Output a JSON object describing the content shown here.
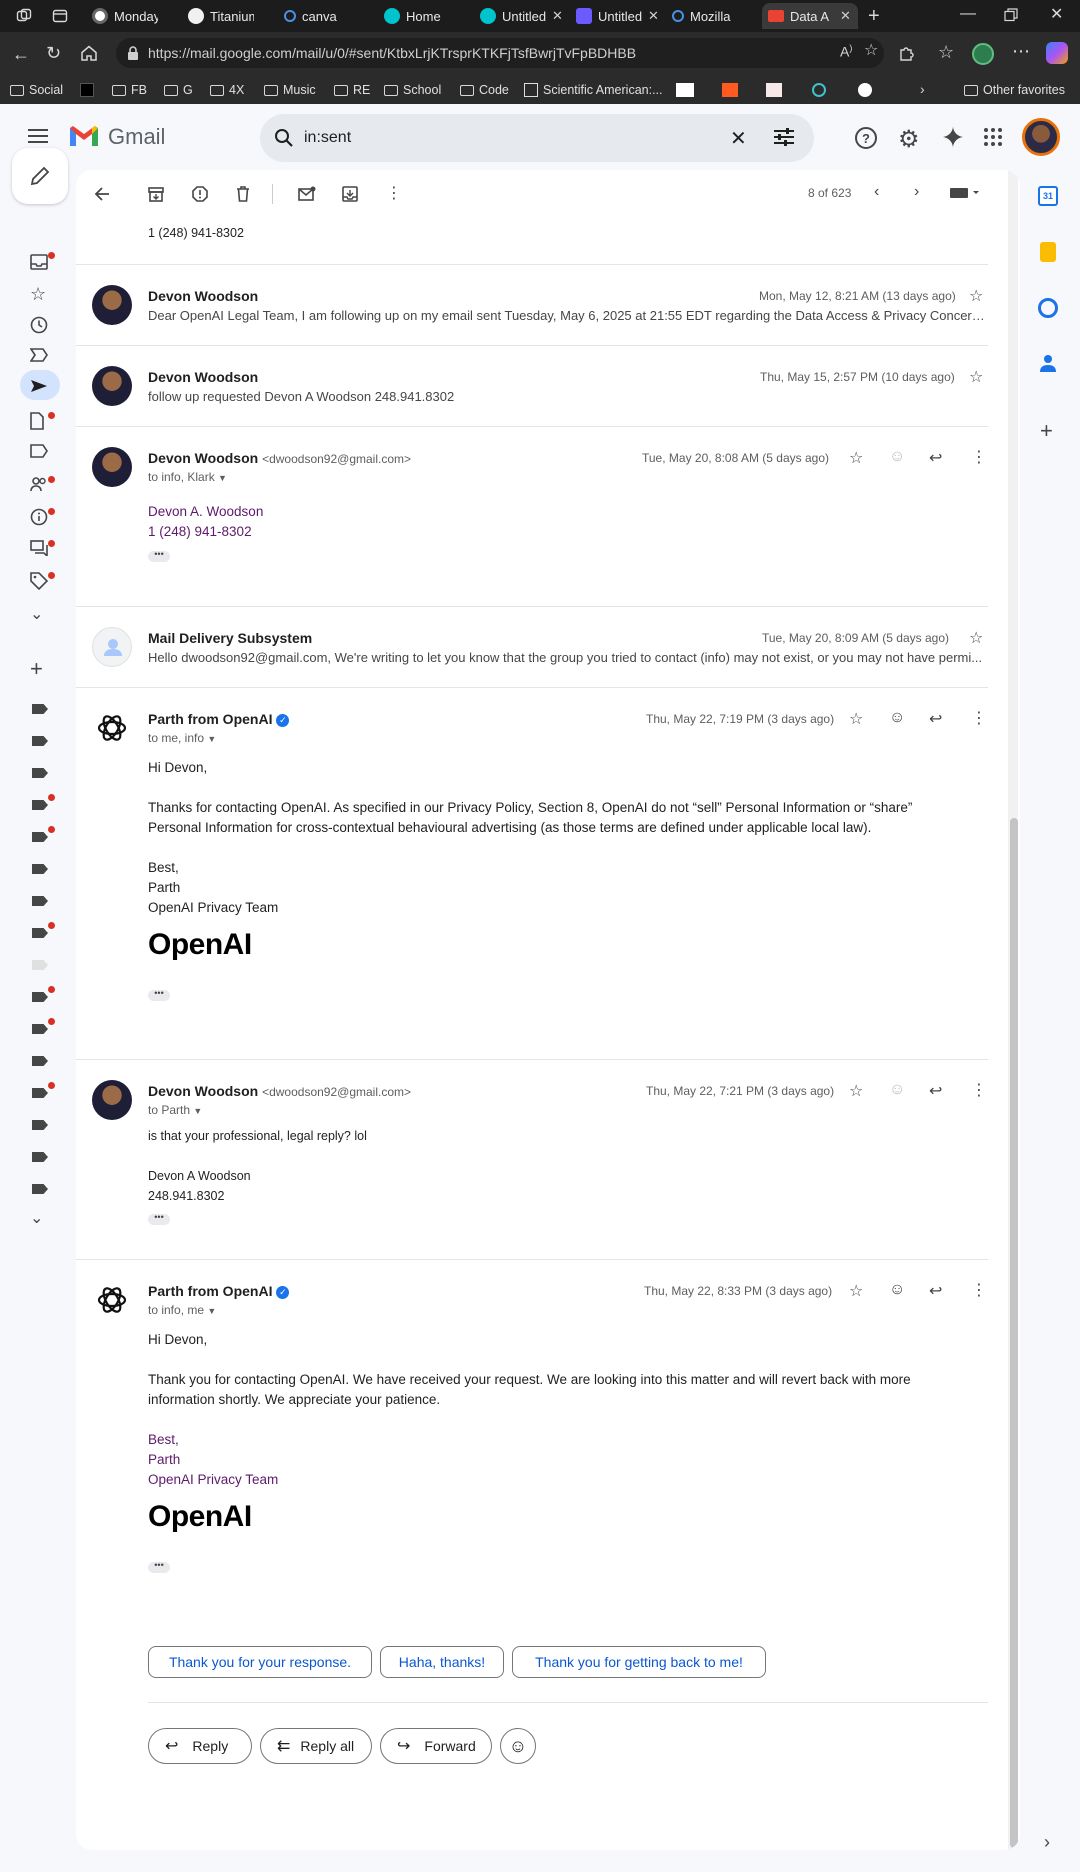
{
  "browser": {
    "tabs": [
      {
        "title": "Monday",
        "color": "#7c4dff"
      },
      {
        "title": "Titanium",
        "color": "#f0f0f0"
      },
      {
        "title": "canva",
        "color": "#4a90e2"
      },
      {
        "title": "Home",
        "color": "#00c4cc"
      },
      {
        "title": "Untitled",
        "color": "#00c4cc"
      },
      {
        "title": "Untitled",
        "color": "#6b5bff"
      },
      {
        "title": "Mozilla",
        "color": "#4a90e2"
      },
      {
        "title": "Data A",
        "color": "#ea4335"
      }
    ],
    "url": "https://mail.google.com/mail/u/0/#sent/KtbxLrjKTrsprKTKFjTsfBwrjTvFpBDHBB",
    "bookmarks": [
      "Social",
      "FB",
      "G",
      "4X",
      "Music",
      "RE",
      "School",
      "Code",
      "Scientific American:...",
      "Other favorites"
    ]
  },
  "gmail": {
    "brand": "Gmail",
    "search_query": "in:sent",
    "pager": "8 of 623"
  },
  "thread": {
    "top_phone": "1 (248) 941-8302",
    "messages": [
      {
        "sender": "Devon Woodson",
        "date": "Mon, May 12, 8:21 AM (13 days ago)",
        "snippet": "Dear OpenAI Legal Team, I am following up on my email sent Tuesday, May 6, 2025 at 21:55 EDT regarding the Data Access & Privacy Concern..."
      },
      {
        "sender": "Devon Woodson",
        "date": "Thu, May 15, 2:57 PM (10 days ago)",
        "snippet": "follow up requested Devon A Woodson 248.941.8302"
      },
      {
        "sender": "Devon Woodson",
        "email": "<dwoodson92@gmail.com>",
        "date": "Tue, May 20, 8:08 AM (5 days ago)",
        "to": "to info, Klark",
        "sig_name": "Devon A. Woodson",
        "sig_phone": "1 (248) 941-8302"
      },
      {
        "sender": "Mail Delivery Subsystem",
        "date": "Tue, May 20, 8:09 AM (5 days ago)",
        "snippet": "Hello dwoodson92@gmail.com, We're writing to let you know that the group you tried to contact (info) may not exist, or you may not have permi..."
      },
      {
        "sender": "Parth from OpenAI",
        "date": "Thu, May 22, 7:19 PM (3 days ago)",
        "to": "to me, info",
        "greeting": "Hi Devon,",
        "body1": "Thanks for contacting OpenAI. As specified in our Privacy Policy, Section 8, OpenAI do not “sell” Personal Information or “share”",
        "body2": "Personal Information for cross-contextual behavioural advertising (as those terms are defined under applicable local law).",
        "sign1": "Best,",
        "sign2": "Parth",
        "sign3": "OpenAI Privacy Team",
        "logo": "OpenAI"
      },
      {
        "sender": "Devon Woodson",
        "email": "<dwoodson92@gmail.com>",
        "date": "Thu, May 22, 7:21 PM (3 days ago)",
        "to": "to Parth",
        "body1": "is that your professional, legal reply? lol",
        "sig_name": "Devon A Woodson",
        "sig_phone": "248.941.8302"
      },
      {
        "sender": "Parth from OpenAI",
        "date": "Thu, May 22, 8:33 PM (3 days ago)",
        "to": "to info, me",
        "greeting": "Hi Devon,",
        "body1": "Thank you for contacting OpenAI. We have received your request. We are looking into this matter and will revert back with more",
        "body2": "information shortly. We appreciate your patience.",
        "sign1": "Best,",
        "sign2": "Parth",
        "sign3": "OpenAI Privacy Team",
        "logo": "OpenAI"
      }
    ],
    "smart_replies": [
      "Thank you for your response.",
      "Haha, thanks!",
      "Thank you for getting back to me!"
    ],
    "actions": {
      "reply": "Reply",
      "reply_all": "Reply all",
      "forward": "Forward"
    }
  }
}
